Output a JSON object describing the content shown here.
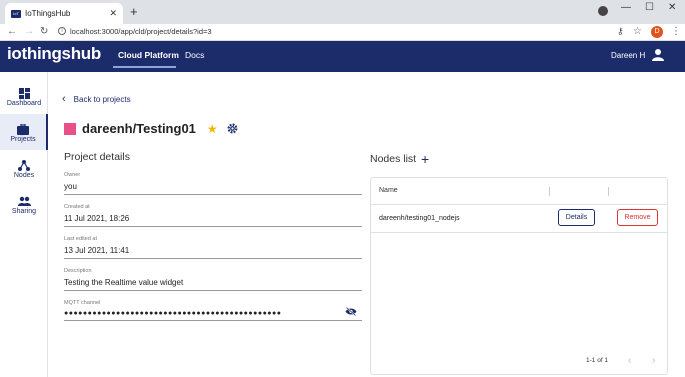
{
  "browser": {
    "tab_title": "IoThingsHub",
    "favicon_text": "IoT",
    "url": "localhost:3000/app/cld/project/details?id=3",
    "profile_initial": "D"
  },
  "header": {
    "logo": "iothingshub",
    "nav": [
      "Cloud Platform",
      "Docs"
    ],
    "user_name": "Dareen H"
  },
  "sidebar": {
    "items": [
      {
        "label": "Dashboard",
        "icon": "dashboard-icon"
      },
      {
        "label": "Projects",
        "icon": "briefcase-icon",
        "active": true
      },
      {
        "label": "Nodes",
        "icon": "nodes-icon"
      },
      {
        "label": "Sharing",
        "icon": "people-icon"
      }
    ]
  },
  "main": {
    "back_label": "Back to projects",
    "project_title": "dareenh/Testing01",
    "project_color": "#e8508a",
    "details_title": "Project details",
    "fields": [
      {
        "label": "Owner",
        "value": "you"
      },
      {
        "label": "Created at",
        "value": "11 Jul 2021, 18:26"
      },
      {
        "label": "Last edited at",
        "value": "13 Jul 2021, 11:41"
      },
      {
        "label": "Description",
        "value": "Testing the Realtime value widget"
      },
      {
        "label": "MQTT channel",
        "value": "●●●●●●●●●●●●●●●●●●●●●●●●●●●●●●●●●●●●●●●●●●●●●●"
      }
    ],
    "nodes": {
      "title": "Nodes list",
      "add_label": "+",
      "column_name": "Name",
      "rows": [
        {
          "name": "dareenh/testing01_nodejs",
          "details_label": "Details",
          "remove_label": "Remove"
        }
      ],
      "pagination": "1-1 of 1"
    }
  },
  "colors": {
    "brand": "#1c2c6b",
    "accent_star": "#f4b400",
    "danger": "#dd3333"
  }
}
